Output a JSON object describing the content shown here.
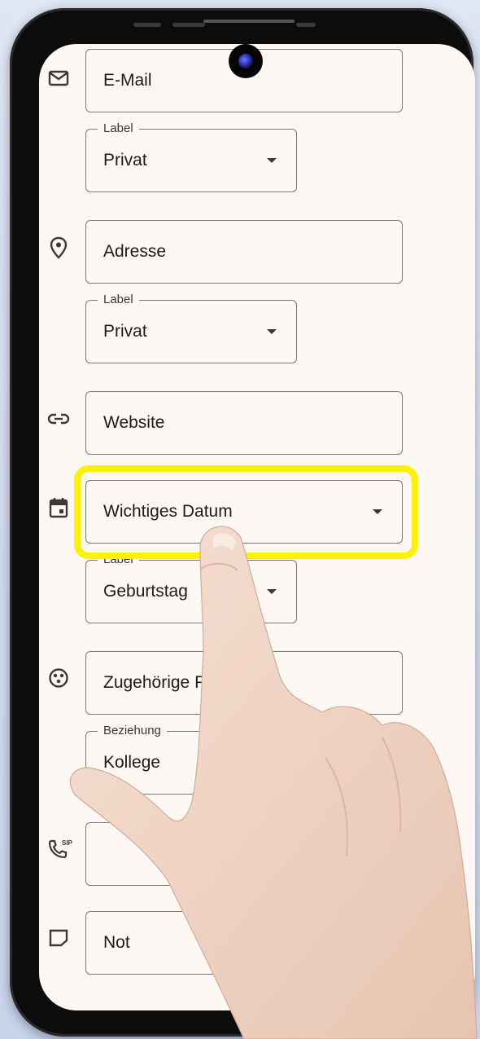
{
  "fields": [
    {
      "id": "email",
      "value": "E-Mail",
      "icon": "email-icon"
    },
    {
      "id": "email_label",
      "float_label": "Label",
      "value": "Privat"
    },
    {
      "id": "address",
      "value": "Adresse",
      "icon": "location-pin-icon"
    },
    {
      "id": "address_label",
      "float_label": "Label",
      "value": "Privat"
    },
    {
      "id": "website",
      "value": "Website",
      "icon": "link-icon"
    },
    {
      "id": "important_date",
      "value": "Wichtiges Datum",
      "icon": "calendar-icon"
    },
    {
      "id": "date_label",
      "float_label": "Label",
      "value": "Geburtstag"
    },
    {
      "id": "related_person",
      "value": "Zugehörige Pe",
      "icon": "relation-icon"
    },
    {
      "id": "relation",
      "float_label": "Beziehung",
      "value": "Kollege"
    },
    {
      "id": "sip",
      "value": "",
      "icon": "sip-phone-icon"
    },
    {
      "id": "notes",
      "value": "Not",
      "icon": "notes-icon"
    }
  ],
  "icon_texts": {
    "sip_badge": "SIP"
  },
  "colors": {
    "highlight": "#fff200",
    "screen_bg": "#fdf8f4",
    "outline": "#7d7774"
  }
}
